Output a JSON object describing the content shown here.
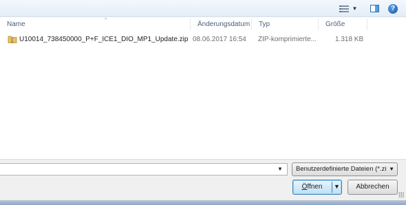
{
  "toolbar": {
    "views_icon": "views-list-icon",
    "preview_icon": "preview-pane-icon",
    "help_icon": "help-icon",
    "help_symbol": "?",
    "dropdown_arrow": "▼"
  },
  "columns": {
    "name": "Name",
    "date": "Änderungsdatum",
    "type": "Typ",
    "size": "Größe",
    "sort_arrow": "^"
  },
  "files": [
    {
      "icon": "zip-folder-icon",
      "name": "U10014_738450000_P+F_ICE1_DIO_MP1_Update.zip",
      "date": "08.06.2017 16:54",
      "type": "ZIP-komprimierte...",
      "size": "1.318 KB"
    }
  ],
  "bottom": {
    "filename_value": "",
    "filename_arrow": "▼",
    "filter_label": "Benutzerdefinierte Dateien (*.zi",
    "filter_arrow": "▼",
    "open_label_prefix": "",
    "open_label_underlined": "Ö",
    "open_label_rest": "ffnen",
    "open_arrow": "▼",
    "cancel_label": "Abbrechen"
  },
  "colors": {
    "accent_blue": "#3c7fb1",
    "header_text": "#4c607a",
    "panel_bg": "#f0f0f0"
  }
}
